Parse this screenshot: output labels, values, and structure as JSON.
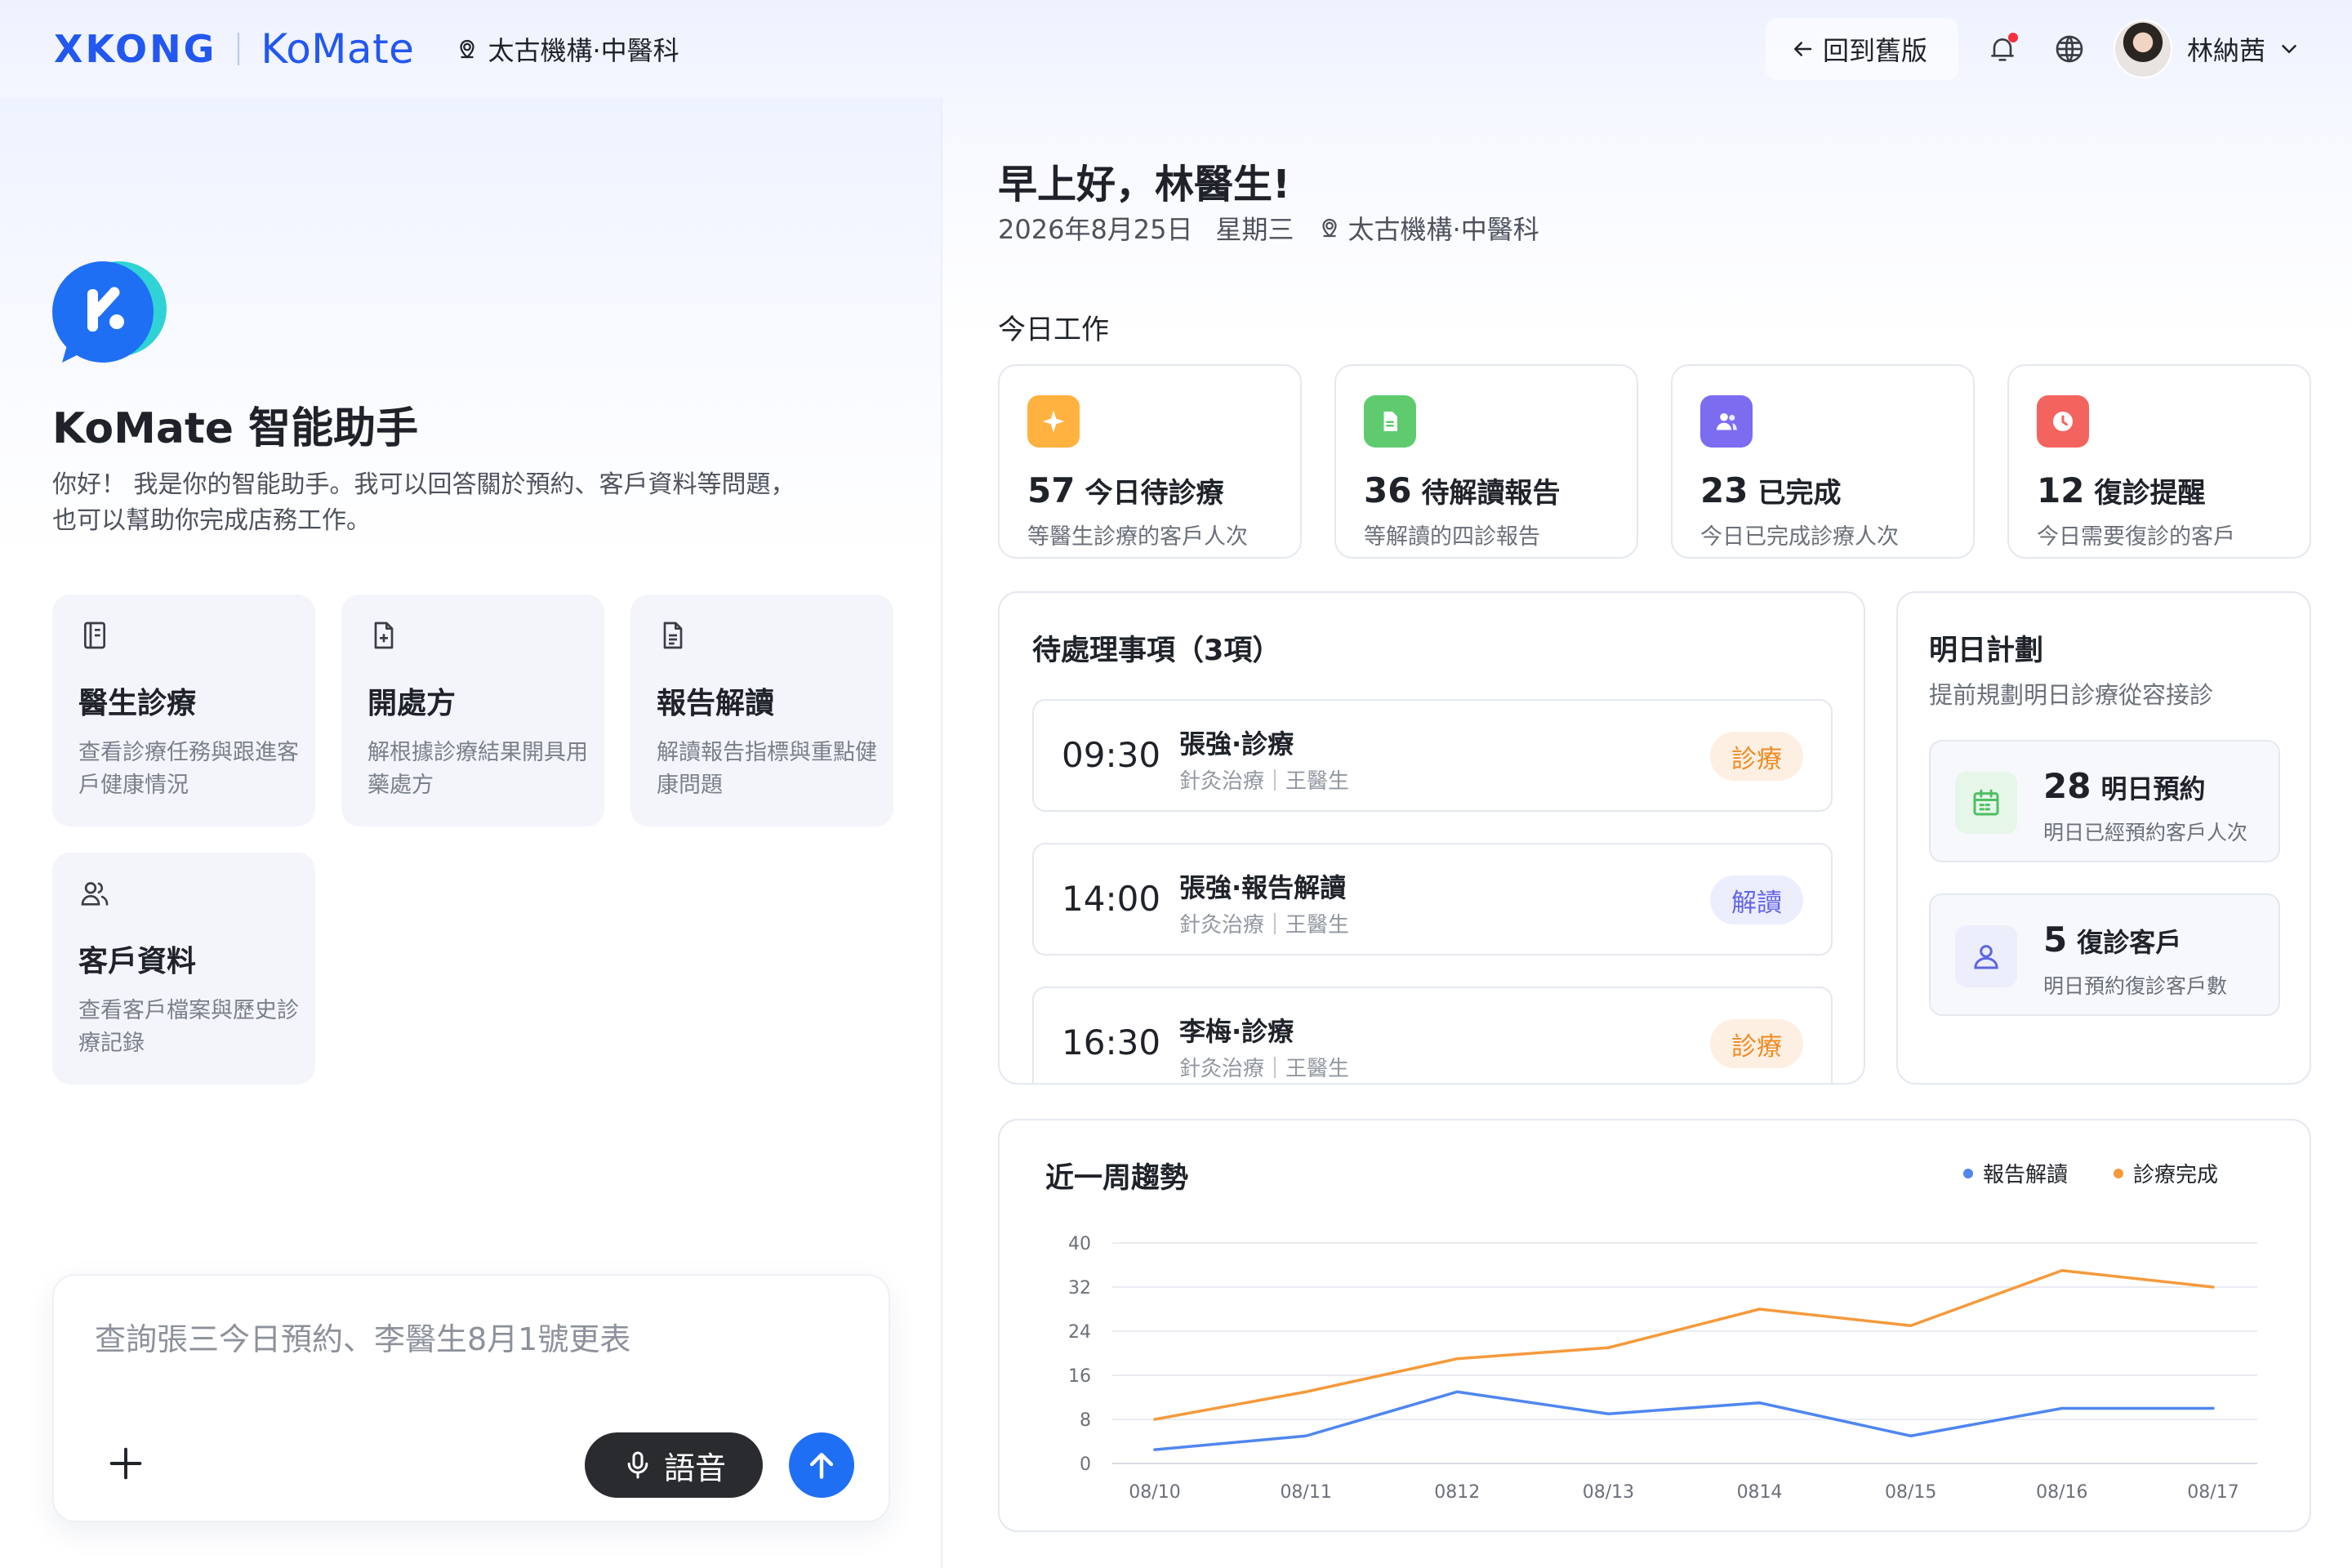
{
  "header": {
    "brand_main": "XKONG",
    "brand_product": "KoMate",
    "org": "太古機構·中醫科",
    "back_label": "回到舊版",
    "user_name": "林納茜"
  },
  "assistant": {
    "title": "KoMate 智能助手",
    "desc_line1": "你好！ 我是你的智能助手。我可以回答關於預約、客戶資料等問題，",
    "desc_line2": "也可以幫助你完成店務工作。",
    "features": [
      {
        "title": "醫生診療",
        "desc": "查看診療任務與跟進客戶健康情況",
        "icon": "notebook-icon"
      },
      {
        "title": "開處方",
        "desc": "解根據診療結果開具用藥處方",
        "icon": "prescription-icon"
      },
      {
        "title": "報告解讀",
        "desc": "解讀報告指標與重點健康問題",
        "icon": "report-icon"
      },
      {
        "title": "客戶資料",
        "desc": "查看客戶檔案與歷史診療記錄",
        "icon": "users-icon"
      }
    ],
    "input_placeholder": "查詢張三今日預約、李醫生8月1號更表",
    "voice_label": "語音"
  },
  "dashboard": {
    "greeting": "早上好，林醫生!",
    "date": "2026年8月25日",
    "weekday": "星期三",
    "org": "太古機構·中醫科",
    "today_label": "今日工作",
    "stats": [
      {
        "num": "57",
        "label": "今日待診療",
        "sub": "等醫生診療的客戶人次",
        "color": "#ffb23f",
        "icon": "sparkle-icon"
      },
      {
        "num": "36",
        "label": "待解讀報告",
        "sub": "等解讀的四診報告",
        "color": "#5fcb6e",
        "icon": "document-icon"
      },
      {
        "num": "23",
        "label": "已完成",
        "sub": "今日已完成診療人次",
        "color": "#7c6cf0",
        "icon": "people-icon"
      },
      {
        "num": "12",
        "label": "復診提醒",
        "sub": "今日需要復診的客戶",
        "color": "#f4645f",
        "icon": "clock-icon"
      }
    ],
    "todo": {
      "title": "待處理事項（3項）",
      "items": [
        {
          "time": "09:30",
          "name": "張強·診療",
          "meta": "針灸治療｜王醫生",
          "tag": "診療",
          "tag_type": "orange"
        },
        {
          "time": "14:00",
          "name": "張強·報告解讀",
          "meta": "針灸治療｜王醫生",
          "tag": "解讀",
          "tag_type": "purple"
        },
        {
          "time": "16:30",
          "name": "李梅·診療",
          "meta": "針灸治療｜王醫生",
          "tag": "診療",
          "tag_type": "orange"
        }
      ]
    },
    "plan": {
      "title": "明日計劃",
      "sub": "提前規劃明日診療從容接診",
      "cards": [
        {
          "num": "28",
          "label": "明日預約",
          "desc": "明日已經預約客戶人次",
          "icon": "calendar-icon"
        },
        {
          "num": "5",
          "label": "復診客戶",
          "desc": "明日預約復診客戶數",
          "icon": "user-icon"
        }
      ]
    },
    "trend_title": "近一周趨勢"
  },
  "chart_data": {
    "type": "line",
    "title": "近一周趨勢",
    "categories": [
      "08/10",
      "08/11",
      "0812",
      "08/13",
      "0814",
      "08/15",
      "08/16",
      "08/17"
    ],
    "ylim": [
      0,
      40
    ],
    "yticks": [
      "0",
      "8",
      "16",
      "24",
      "32",
      "40"
    ],
    "grid": true,
    "legend": "top-right",
    "series": [
      {
        "name": "報告解讀",
        "color": "#4f86f0",
        "values": [
          2.5,
          5,
          13,
          9,
          11,
          5,
          10,
          10
        ]
      },
      {
        "name": "診療完成",
        "color": "#f59a3c",
        "values": [
          8,
          13,
          19,
          21,
          28,
          25,
          35,
          32
        ]
      }
    ]
  }
}
